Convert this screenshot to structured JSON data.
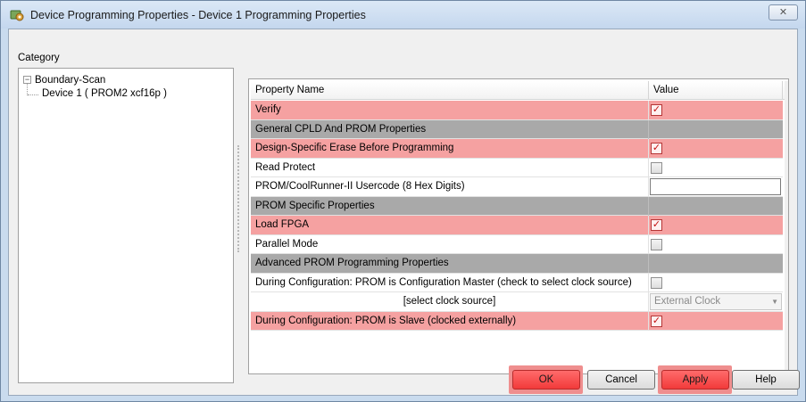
{
  "window": {
    "title": "Device Programming Properties - Device 1 Programming Properties",
    "close_glyph": "✕",
    "icon": "device-programming-icon"
  },
  "category": {
    "label": "Category",
    "tree": {
      "root": {
        "toggle": "−",
        "label": "Boundary-Scan"
      },
      "child": {
        "label": "Device 1 ( PROM2 xcf16p )"
      }
    }
  },
  "properties": {
    "header": {
      "name": "Property Name",
      "value": "Value"
    },
    "rows": [
      {
        "name": "Verify",
        "style": "highlight",
        "control": "checkbox",
        "checked": true
      },
      {
        "name": "General CPLD And PROM Properties",
        "style": "group",
        "control": "none"
      },
      {
        "name": "Design-Specific Erase Before Programming",
        "style": "highlight",
        "control": "checkbox",
        "checked": true
      },
      {
        "name": "Read Protect",
        "style": "normal",
        "control": "checkbox",
        "checked": false
      },
      {
        "name": "PROM/CoolRunner-II Usercode (8 Hex Digits)",
        "style": "normal",
        "control": "text",
        "value": ""
      },
      {
        "name": "PROM Specific Properties",
        "style": "group",
        "control": "none"
      },
      {
        "name": "Load FPGA",
        "style": "highlight",
        "control": "checkbox",
        "checked": true
      },
      {
        "name": "Parallel Mode",
        "style": "normal",
        "control": "checkbox",
        "checked": false
      },
      {
        "name": "Advanced PROM Programming Properties",
        "style": "group",
        "control": "none"
      },
      {
        "name": "During Configuration: PROM is Configuration Master (check to select clock source)",
        "style": "normal",
        "control": "checkbox",
        "checked": false
      },
      {
        "name": "[select clock source]",
        "style": "normal",
        "align": "center",
        "control": "select",
        "value": "External Clock"
      },
      {
        "name": "During Configuration: PROM is Slave (clocked externally)",
        "style": "highlight",
        "control": "checkbox",
        "checked": true
      }
    ]
  },
  "buttons": {
    "ok": "OK",
    "cancel": "Cancel",
    "apply": "Apply",
    "help": "Help"
  },
  "glyphs": {
    "check": "✓",
    "dropdown": "▼"
  },
  "colors": {
    "highlight_row": "#f5a1a1",
    "group_row": "#a9a9a9",
    "highlight_button": "#f23a3a"
  }
}
